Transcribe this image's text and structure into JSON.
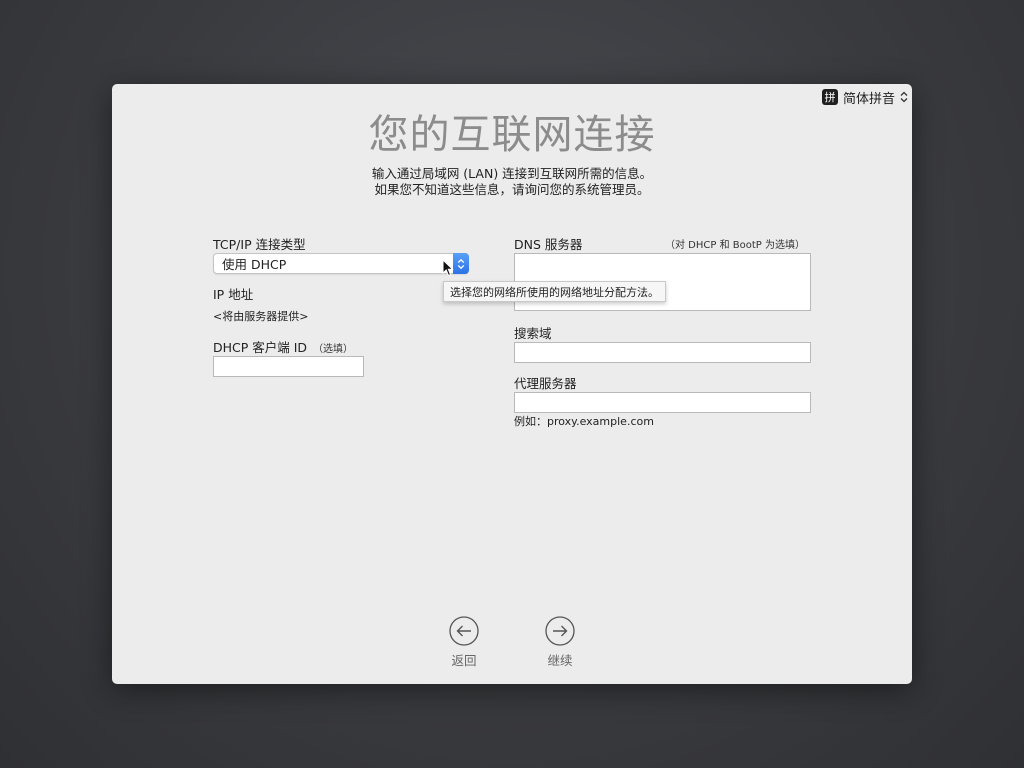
{
  "input_menu": {
    "badge": "拼",
    "label": "简体拼音"
  },
  "title": "您的互联网连接",
  "subtitle": {
    "line1": "输入通过局域网 (LAN) 连接到互联网所需的信息。",
    "line2": "如果您不知道这些信息，请询问您的系统管理员。"
  },
  "left": {
    "tcpip_label": "TCP/IP 连接类型",
    "tcpip_value": "使用 DHCP",
    "tooltip": "选择您的网络所使用的网络地址分配方法。",
    "ip_label": "IP 地址",
    "ip_value": "<将由服务器提供>",
    "dhcp_label": "DHCP 客户端 ID",
    "dhcp_optional": "（选填）",
    "dhcp_value": ""
  },
  "right": {
    "dns_label": "DNS 服务器",
    "dns_note": "（对 DHCP 和 BootP 为选填）",
    "dns_value": "",
    "search_label": "搜索域",
    "search_value": "",
    "proxy_label": "代理服务器",
    "proxy_value": "",
    "proxy_example": "例如：proxy.example.com"
  },
  "nav": {
    "back_label": "返回",
    "continue_label": "继续"
  },
  "colors": {
    "accent": "#2a73e6",
    "window_bg": "#ececec",
    "title_gray": "#8c8c8c"
  },
  "icons": {
    "back": "arrow-left-circle-icon",
    "continue": "arrow-right-circle-icon",
    "select": "up-down-chevron-icon"
  }
}
